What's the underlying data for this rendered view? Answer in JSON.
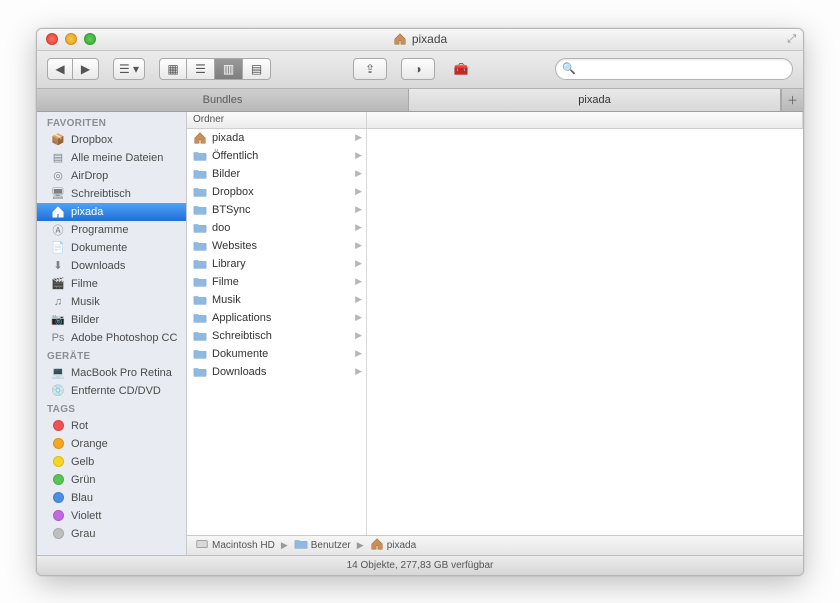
{
  "window": {
    "title": "pixada"
  },
  "tabs": {
    "left": "Bundles",
    "right": "pixada",
    "active": "right"
  },
  "search": {
    "placeholder": ""
  },
  "sidebar": {
    "sections": [
      {
        "header": "FAVORITEN",
        "items": [
          {
            "icon": "dropbox",
            "label": "Dropbox"
          },
          {
            "icon": "doc",
            "label": "Alle meine Dateien"
          },
          {
            "icon": "airdrop",
            "label": "AirDrop"
          },
          {
            "icon": "desktop",
            "label": "Schreibtisch"
          },
          {
            "icon": "home",
            "label": "pixada",
            "selected": true
          },
          {
            "icon": "apps",
            "label": "Programme"
          },
          {
            "icon": "docs",
            "label": "Dokumente"
          },
          {
            "icon": "downloads",
            "label": "Downloads"
          },
          {
            "icon": "movies",
            "label": "Filme"
          },
          {
            "icon": "music",
            "label": "Musik"
          },
          {
            "icon": "pictures",
            "label": "Bilder"
          },
          {
            "icon": "ps",
            "label": "Adobe Photoshop CC"
          }
        ]
      },
      {
        "header": "GERÄTE",
        "items": [
          {
            "icon": "laptop",
            "label": "MacBook Pro Retina"
          },
          {
            "icon": "disc",
            "label": "Entfernte CD/DVD"
          }
        ]
      },
      {
        "header": "TAGS",
        "items": [
          {
            "color": "#ed5353",
            "label": "Rot"
          },
          {
            "color": "#f5a623",
            "label": "Orange"
          },
          {
            "color": "#f5d723",
            "label": "Gelb"
          },
          {
            "color": "#58c458",
            "label": "Grün"
          },
          {
            "color": "#4a90e2",
            "label": "Blau"
          },
          {
            "color": "#c26ae2",
            "label": "Violett"
          },
          {
            "color": "#bfbfbf",
            "label": "Grau"
          }
        ]
      }
    ]
  },
  "columnHeader": "Ordner",
  "folders": [
    {
      "icon": "home",
      "name": "pixada"
    },
    {
      "icon": "folder",
      "name": "Öffentlich"
    },
    {
      "icon": "folder",
      "name": "Bilder"
    },
    {
      "icon": "folder",
      "name": "Dropbox"
    },
    {
      "icon": "folder",
      "name": "BTSync"
    },
    {
      "icon": "folder",
      "name": "doo"
    },
    {
      "icon": "folder",
      "name": "Websites"
    },
    {
      "icon": "folder",
      "name": "Library"
    },
    {
      "icon": "folder",
      "name": "Filme"
    },
    {
      "icon": "folder",
      "name": "Musik"
    },
    {
      "icon": "folder",
      "name": "Applications"
    },
    {
      "icon": "folder",
      "name": "Schreibtisch"
    },
    {
      "icon": "folder",
      "name": "Dokumente"
    },
    {
      "icon": "folder",
      "name": "Downloads"
    }
  ],
  "path": [
    {
      "icon": "hdd",
      "label": "Macintosh HD"
    },
    {
      "icon": "folder",
      "label": "Benutzer"
    },
    {
      "icon": "home",
      "label": "pixada"
    }
  ],
  "status": "14 Objekte, 277,83 GB verfügbar"
}
